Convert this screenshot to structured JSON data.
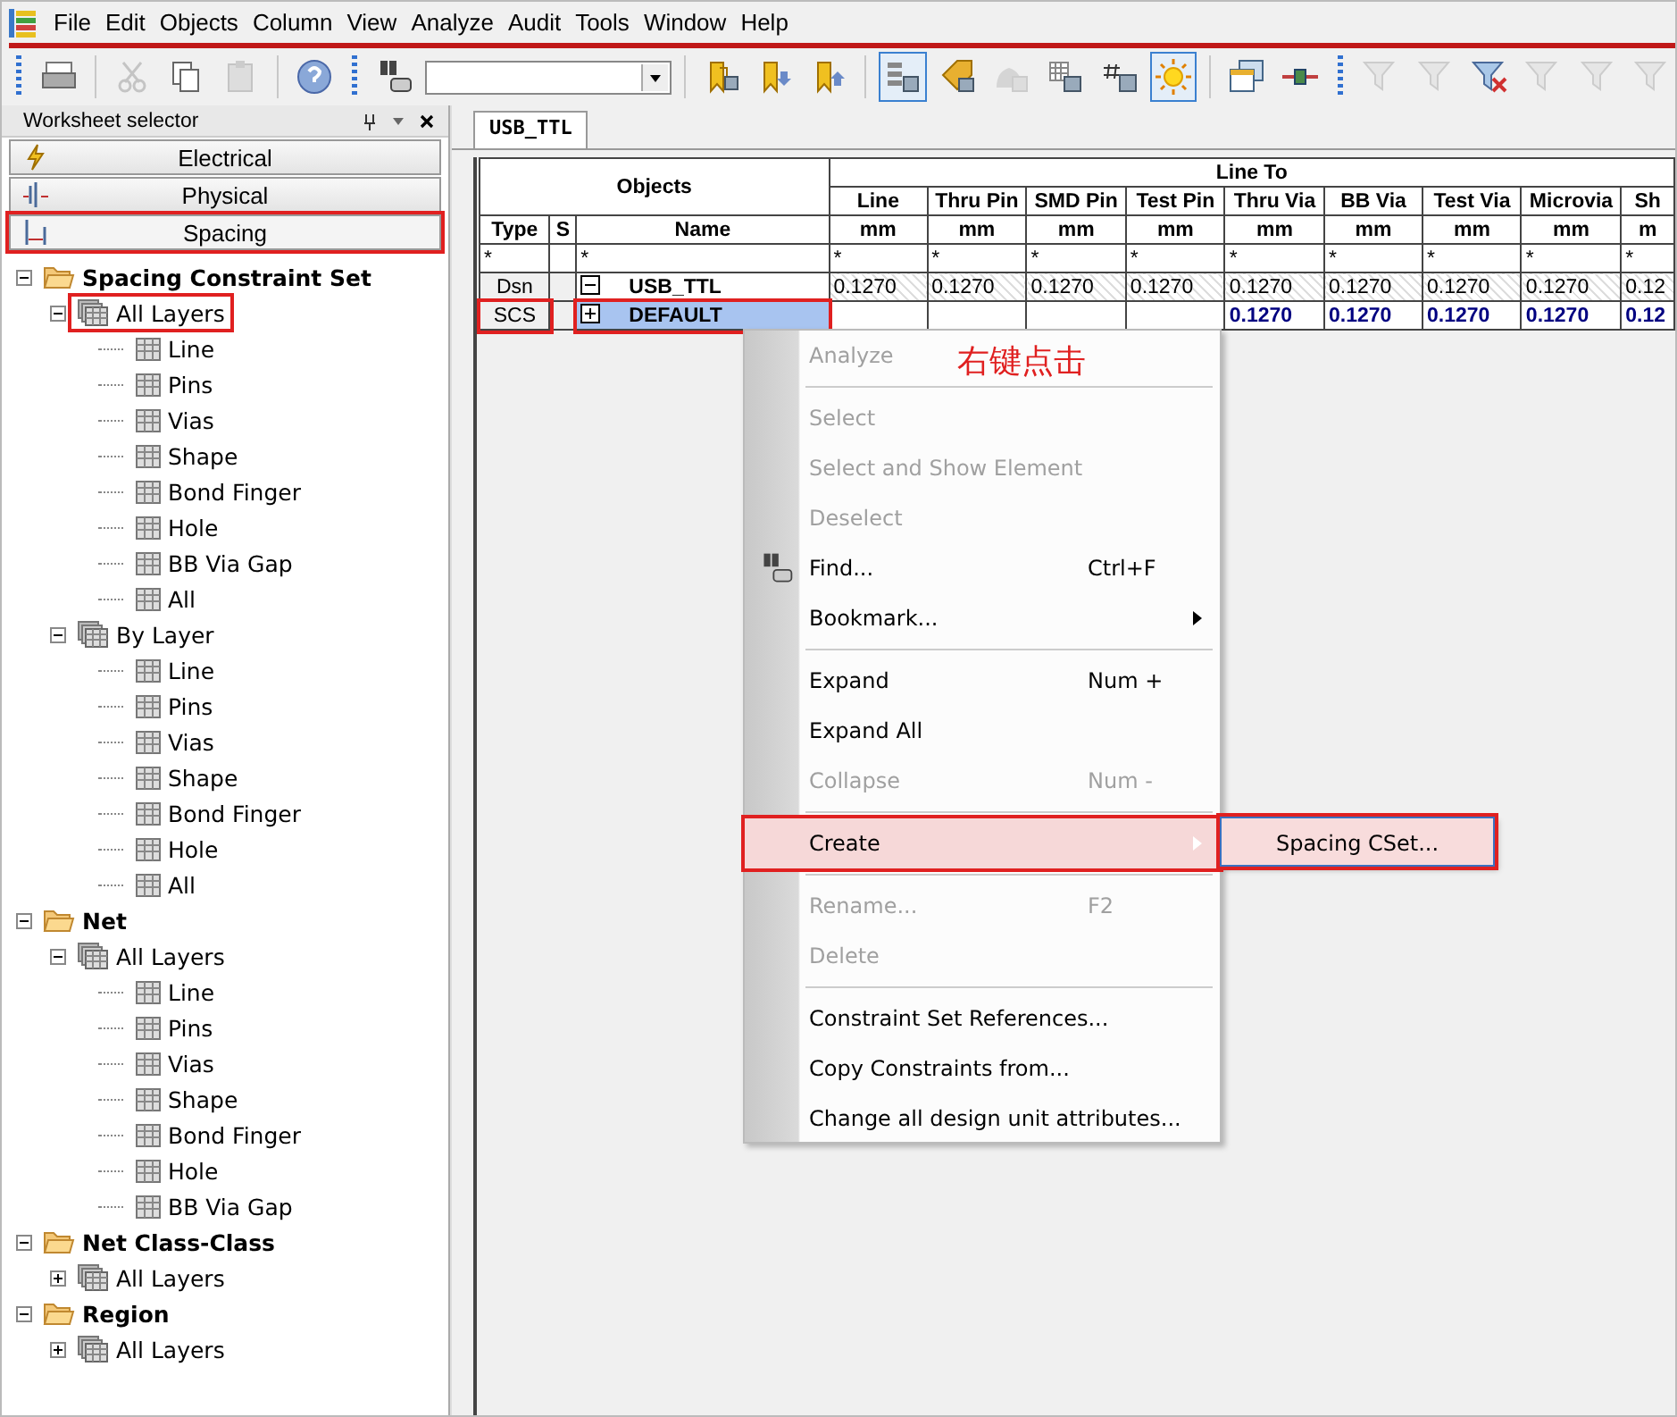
{
  "menubar": [
    "File",
    "Edit",
    "Objects",
    "Column",
    "View",
    "Analyze",
    "Audit",
    "Tools",
    "Window",
    "Help"
  ],
  "toolbar": [
    {
      "kind": "grip"
    },
    {
      "kind": "print",
      "disabled": false,
      "pressed": false
    },
    {
      "kind": "sep"
    },
    {
      "kind": "cut",
      "disabled": true,
      "pressed": false
    },
    {
      "kind": "copy",
      "disabled": false,
      "pressed": false
    },
    {
      "kind": "paste",
      "disabled": true,
      "pressed": false
    },
    {
      "kind": "sep"
    },
    {
      "kind": "help",
      "disabled": false,
      "pressed": false
    },
    {
      "kind": "grip"
    },
    {
      "kind": "find",
      "disabled": false,
      "pressed": false
    },
    {
      "kind": "combo"
    },
    {
      "kind": "sep"
    },
    {
      "kind": "bookmark",
      "disabled": false,
      "pressed": false
    },
    {
      "kind": "bookmark-down",
      "disabled": false,
      "pressed": false
    },
    {
      "kind": "bookmark-up",
      "disabled": false,
      "pressed": false
    },
    {
      "kind": "sep"
    },
    {
      "kind": "list",
      "disabled": false,
      "pressed": true
    },
    {
      "kind": "tag",
      "disabled": false,
      "pressed": false
    },
    {
      "kind": "cloud",
      "disabled": true,
      "pressed": false
    },
    {
      "kind": "grid",
      "disabled": false,
      "pressed": false
    },
    {
      "kind": "hash",
      "disabled": false,
      "pressed": false
    },
    {
      "kind": "sun",
      "disabled": false,
      "pressed": true
    },
    {
      "kind": "sep"
    },
    {
      "kind": "windows",
      "disabled": false,
      "pressed": false
    },
    {
      "kind": "link",
      "disabled": false,
      "pressed": false
    },
    {
      "kind": "grip"
    },
    {
      "kind": "filter",
      "disabled": true,
      "pressed": false
    },
    {
      "kind": "filter",
      "disabled": true,
      "pressed": false
    },
    {
      "kind": "filter-x",
      "disabled": false,
      "pressed": false
    },
    {
      "kind": "filter",
      "disabled": true,
      "pressed": false
    },
    {
      "kind": "filter",
      "disabled": true,
      "pressed": false
    },
    {
      "kind": "filter",
      "disabled": true,
      "pressed": false
    }
  ],
  "sidebar": {
    "title": "Worksheet selector",
    "worksheets": [
      {
        "label": "Electrical",
        "kind": "electrical",
        "selected": false,
        "annotated": false
      },
      {
        "label": "Physical",
        "kind": "physical",
        "selected": false,
        "annotated": false
      },
      {
        "label": "Spacing",
        "kind": "spacing",
        "selected": true,
        "annotated": true
      }
    ],
    "tree": [
      {
        "label": "Spacing Constraint Set",
        "kind": "folder",
        "expanded": true,
        "annotated": false,
        "children": [
          {
            "label": "All Layers",
            "kind": "layers",
            "expanded": true,
            "annotated": true,
            "children": [
              {
                "label": "Line",
                "kind": "sheet"
              },
              {
                "label": "Pins",
                "kind": "sheet"
              },
              {
                "label": "Vias",
                "kind": "sheet"
              },
              {
                "label": "Shape",
                "kind": "sheet"
              },
              {
                "label": "Bond Finger",
                "kind": "sheet"
              },
              {
                "label": "Hole",
                "kind": "sheet"
              },
              {
                "label": "BB Via Gap",
                "kind": "sheet"
              },
              {
                "label": "All",
                "kind": "sheet"
              }
            ]
          },
          {
            "label": "By Layer",
            "kind": "layers",
            "expanded": true,
            "annotated": false,
            "children": [
              {
                "label": "Line",
                "kind": "sheet"
              },
              {
                "label": "Pins",
                "kind": "sheet"
              },
              {
                "label": "Vias",
                "kind": "sheet"
              },
              {
                "label": "Shape",
                "kind": "sheet"
              },
              {
                "label": "Bond Finger",
                "kind": "sheet"
              },
              {
                "label": "Hole",
                "kind": "sheet"
              },
              {
                "label": "All",
                "kind": "sheet"
              }
            ]
          }
        ]
      },
      {
        "label": "Net",
        "kind": "folder",
        "expanded": true,
        "annotated": false,
        "children": [
          {
            "label": "All Layers",
            "kind": "layers",
            "expanded": true,
            "annotated": false,
            "children": [
              {
                "label": "Line",
                "kind": "sheet"
              },
              {
                "label": "Pins",
                "kind": "sheet"
              },
              {
                "label": "Vias",
                "kind": "sheet"
              },
              {
                "label": "Shape",
                "kind": "sheet"
              },
              {
                "label": "Bond Finger",
                "kind": "sheet"
              },
              {
                "label": "Hole",
                "kind": "sheet"
              },
              {
                "label": "BB Via Gap",
                "kind": "sheet"
              }
            ]
          }
        ]
      },
      {
        "label": "Net Class-Class",
        "kind": "folder",
        "expanded": true,
        "annotated": false,
        "children": [
          {
            "label": "All Layers",
            "kind": "layers",
            "expanded": false,
            "annotated": false
          }
        ]
      },
      {
        "label": "Region",
        "kind": "folder",
        "expanded": true,
        "annotated": false,
        "children": [
          {
            "label": "All Layers",
            "kind": "layers",
            "expanded": false,
            "annotated": false
          }
        ]
      }
    ]
  },
  "tab": {
    "label": "USB_TTL"
  },
  "grid": {
    "objects_header": "Objects",
    "group_header": "Line To",
    "object_columns": [
      "Type",
      "S",
      "Name"
    ],
    "columns": [
      {
        "label": "Line",
        "unit": "mm"
      },
      {
        "label": "Thru Pin",
        "unit": "mm"
      },
      {
        "label": "SMD Pin",
        "unit": "mm"
      },
      {
        "label": "Test Pin",
        "unit": "mm"
      },
      {
        "label": "Thru Via",
        "unit": "mm"
      },
      {
        "label": "BB Via",
        "unit": "mm"
      },
      {
        "label": "Test Via",
        "unit": "mm"
      },
      {
        "label": "Microvia",
        "unit": "mm"
      },
      {
        "label": "Sh",
        "unit": "m"
      }
    ],
    "filters": [
      "*",
      "*",
      "*",
      "*",
      "*",
      "*",
      "*",
      "*",
      "*",
      "*",
      "*"
    ],
    "rows": [
      {
        "type": "Dsn",
        "name": "USB_TTL",
        "kind": "design",
        "expanded": true,
        "selected": false,
        "annotated": false,
        "values": [
          "0.1270",
          "0.1270",
          "0.1270",
          "0.1270",
          "0.1270",
          "0.1270",
          "0.1270",
          "0.1270",
          "0.12"
        ]
      },
      {
        "type": "SCS",
        "name": "DEFAULT",
        "kind": "cset",
        "expanded": false,
        "selected": true,
        "annotated": true,
        "values": [
          "0.1270",
          "0.1270",
          "0.1270",
          "0.1270",
          "0.12"
        ]
      }
    ]
  },
  "context_menu": {
    "items": [
      {
        "kind": "item",
        "label": "Analyze",
        "disabled": true
      },
      {
        "kind": "sep"
      },
      {
        "kind": "item",
        "label": "Select",
        "disabled": true
      },
      {
        "kind": "item",
        "label": "Select and Show Element",
        "disabled": true
      },
      {
        "kind": "item",
        "label": "Deselect",
        "disabled": true
      },
      {
        "kind": "icon-item",
        "label": "Find...",
        "shortcut": "Ctrl+F",
        "disabled": false
      },
      {
        "kind": "item",
        "label": "Bookmark...",
        "disabled": false,
        "submenu": true
      },
      {
        "kind": "sep"
      },
      {
        "kind": "item",
        "label": "Expand",
        "shortcut": "Num +",
        "disabled": false
      },
      {
        "kind": "item",
        "label": "Expand All",
        "disabled": false
      },
      {
        "kind": "item",
        "label": "Collapse",
        "shortcut": "Num -",
        "disabled": true
      },
      {
        "kind": "sep"
      },
      {
        "kind": "item",
        "label": "Create",
        "disabled": false,
        "submenu": true,
        "selected": true,
        "annotated": true
      },
      {
        "kind": "sep"
      },
      {
        "kind": "item",
        "label": "Rename...",
        "shortcut": "F2",
        "disabled": true
      },
      {
        "kind": "item",
        "label": "Delete",
        "disabled": true
      },
      {
        "kind": "sep"
      },
      {
        "kind": "item",
        "label": "Constraint Set References...",
        "disabled": false
      },
      {
        "kind": "item",
        "label": "Copy Constraints from...",
        "disabled": false
      },
      {
        "kind": "item",
        "label": "Change all design unit attributes...",
        "disabled": false
      }
    ],
    "submenu": {
      "label": "Spacing CSet...",
      "selected": true,
      "annotated": true
    }
  },
  "annotation": {
    "text": "右键点击"
  }
}
